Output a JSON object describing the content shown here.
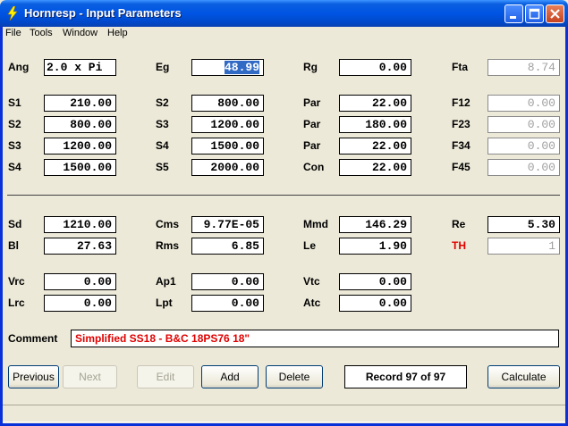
{
  "window": {
    "title": "Hornresp - Input Parameters"
  },
  "menu": [
    "File",
    "Tools",
    "Window",
    "Help"
  ],
  "fields": {
    "ang": {
      "label": "Ang",
      "value": "2.0 x Pi"
    },
    "eg": {
      "label": "Eg",
      "value": "48.99"
    },
    "rg": {
      "label": "Rg",
      "value": "0.00"
    },
    "fta": {
      "label": "Fta",
      "value": "8.74"
    },
    "s1": {
      "label": "S1",
      "value": "210.00"
    },
    "s2a": {
      "label": "S2",
      "value": "800.00"
    },
    "par1": {
      "label": "Par",
      "value": "22.00"
    },
    "f12": {
      "label": "F12",
      "value": "0.00"
    },
    "s2b": {
      "label": "S2",
      "value": "800.00"
    },
    "s3a": {
      "label": "S3",
      "value": "1200.00"
    },
    "par2": {
      "label": "Par",
      "value": "180.00"
    },
    "f23": {
      "label": "F23",
      "value": "0.00"
    },
    "s3b": {
      "label": "S3",
      "value": "1200.00"
    },
    "s4a": {
      "label": "S4",
      "value": "1500.00"
    },
    "par3": {
      "label": "Par",
      "value": "22.00"
    },
    "f34": {
      "label": "F34",
      "value": "0.00"
    },
    "s4b": {
      "label": "S4",
      "value": "1500.00"
    },
    "s5": {
      "label": "S5",
      "value": "2000.00"
    },
    "con": {
      "label": "Con",
      "value": "22.00"
    },
    "f45": {
      "label": "F45",
      "value": "0.00"
    },
    "sd": {
      "label": "Sd",
      "value": "1210.00"
    },
    "cms": {
      "label": "Cms",
      "value": "9.77E-05"
    },
    "mmd": {
      "label": "Mmd",
      "value": "146.29"
    },
    "re": {
      "label": "Re",
      "value": "5.30"
    },
    "bl": {
      "label": "Bl",
      "value": "27.63"
    },
    "rms": {
      "label": "Rms",
      "value": "6.85"
    },
    "le": {
      "label": "Le",
      "value": "1.90"
    },
    "th": {
      "label": "TH",
      "value": "1"
    },
    "vrc": {
      "label": "Vrc",
      "value": "0.00"
    },
    "ap1": {
      "label": "Ap1",
      "value": "0.00"
    },
    "vtc": {
      "label": "Vtc",
      "value": "0.00"
    },
    "lrc": {
      "label": "Lrc",
      "value": "0.00"
    },
    "lpt": {
      "label": "Lpt",
      "value": "0.00"
    },
    "atc": {
      "label": "Atc",
      "value": "0.00"
    }
  },
  "comment": {
    "label": "Comment",
    "value": "Simplified SS18 - B&C 18PS76 18\""
  },
  "buttons": {
    "previous": "Previous",
    "next": "Next",
    "edit": "Edit",
    "add": "Add",
    "delete": "Delete",
    "calculate": "Calculate"
  },
  "record": "Record 97 of 97",
  "colors": {
    "title_bar": "#0054e3",
    "highlight_label": "#e00000",
    "comment_text": "#e00000",
    "selection": "#316ac5"
  }
}
